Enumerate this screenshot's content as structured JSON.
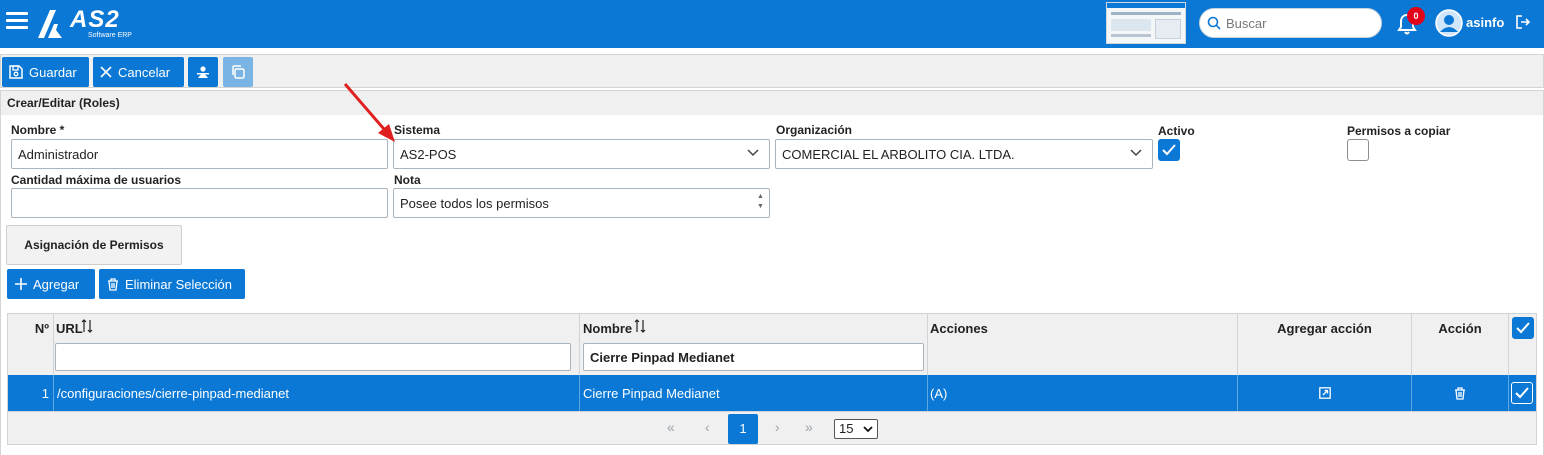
{
  "app": {
    "logo_text": "AS2",
    "logo_subtitle": "Software ERP",
    "search_placeholder": "Buscar",
    "notification_count": "0",
    "username": "asinfo"
  },
  "toolbar": {
    "save_label": "Guardar",
    "cancel_label": "Cancelar"
  },
  "panel": {
    "title": "Crear/Editar (Roles)"
  },
  "form": {
    "nombre_label": "Nombre *",
    "nombre_value": "Administrador",
    "sistema_label": "Sistema",
    "sistema_value": "AS2-POS",
    "organizacion_label": "Organización",
    "organizacion_value": "COMERCIAL EL ARBOLITO CIA. LTDA.",
    "activo_label": "Activo",
    "activo_checked": true,
    "permisos_copiar_label": "Permisos a copiar",
    "permisos_copiar_checked": false,
    "cantidad_label": "Cantidad máxima de usuarios",
    "cantidad_value": "",
    "nota_label": "Nota",
    "nota_value": "Posee todos los permisos"
  },
  "permissions": {
    "assign_button": "Asignación de Permisos",
    "add_button": "Agregar",
    "delete_button": "Eliminar Selección"
  },
  "table": {
    "columns": {
      "num": "Nº",
      "url": "URL",
      "nombre": "Nombre",
      "acciones": "Acciones",
      "agregar_accion": "Agregar acción",
      "accion": "Acción"
    },
    "filters": {
      "url": "",
      "nombre": "Cierre Pinpad Medianet"
    },
    "rows": [
      {
        "num": "1",
        "url": "/configuraciones/cierre-pinpad-medianet",
        "nombre": "Cierre Pinpad Medianet",
        "acciones": "(A)",
        "selected": true
      }
    ],
    "pagination": {
      "current_page": "1",
      "page_size": "15"
    }
  }
}
